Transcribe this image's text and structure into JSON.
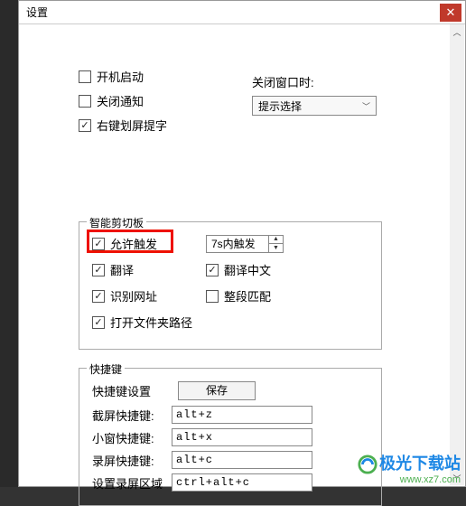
{
  "title": "设置",
  "general": {
    "startup": {
      "label": "开机启动",
      "checked": false
    },
    "close_notify": {
      "label": "关闭通知",
      "checked": false
    },
    "rightclick_capture": {
      "label": "右键划屏提字",
      "checked": true
    }
  },
  "close_window": {
    "label": "关闭窗口时:",
    "selected": "提示选择"
  },
  "clipboard": {
    "legend": "智能剪切板",
    "allow_trigger": {
      "label": "允许触发",
      "checked": true
    },
    "trigger_time": "7s内触发",
    "translate": {
      "label": "翻译",
      "checked": true
    },
    "translate_cn": {
      "label": "翻译中文",
      "checked": true
    },
    "detect_url": {
      "label": "识别网址",
      "checked": true
    },
    "segment_match": {
      "label": "整段匹配",
      "checked": false
    },
    "open_folder_path": {
      "label": "打开文件夹路径",
      "checked": true
    }
  },
  "hotkeys": {
    "legend": "快捷键",
    "settings_label": "快捷键设置",
    "save_label": "保存",
    "rows": [
      {
        "label": "截屏快捷键:",
        "value": "alt+z"
      },
      {
        "label": "小窗快捷键:",
        "value": "alt+x"
      },
      {
        "label": "录屏快捷键:",
        "value": "alt+c"
      },
      {
        "label": "设置录屏区域",
        "value": "ctrl+alt+c"
      }
    ]
  },
  "watermark": {
    "name": "极光下载站",
    "url": "www.xz7.com"
  }
}
